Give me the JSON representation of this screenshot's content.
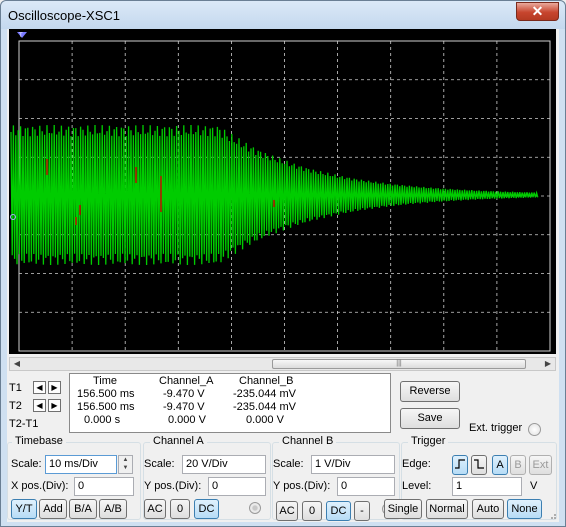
{
  "window": {
    "title": "Oscilloscope-XSC1",
    "close_label": "✕"
  },
  "screen": {
    "background": "#000000",
    "grid_color": "#d0d0d0",
    "trace_color": "#00cc00",
    "cursor_color": "#cc0000",
    "marker_t1": "T",
    "marker_t2": "T"
  },
  "scrollbar": {
    "left": "◀",
    "right": "▶",
    "grip": "|||"
  },
  "cursors": {
    "t1": {
      "label": "T1",
      "prev": "◀",
      "next": "▶"
    },
    "t2": {
      "label": "T2",
      "prev": "◀",
      "next": "▶"
    },
    "diff": {
      "label": "T2-T1"
    }
  },
  "readout": {
    "headers": [
      "Time",
      "Channel_A",
      "Channel_B"
    ],
    "rows": [
      [
        "156.500 ms",
        "-9.470 V",
        "-235.044 mV"
      ],
      [
        "156.500 ms",
        "-9.470 V",
        "-235.044 mV"
      ],
      [
        "0.000 s",
        "0.000 V",
        "0.000 V"
      ]
    ]
  },
  "buttons": {
    "reverse": "Reverse",
    "save": "Save",
    "ext_trigger": "Ext. trigger"
  },
  "timebase": {
    "title": "Timebase",
    "scale_label": "Scale:",
    "scale_value": "10 ms/Div",
    "xpos_label": "X pos.(Div):",
    "xpos_value": "0",
    "modes": [
      "Y/T",
      "Add",
      "B/A",
      "A/B"
    ]
  },
  "channel_a": {
    "title": "Channel A",
    "scale_label": "Scale:",
    "scale_value": "20  V/Div",
    "ypos_label": "Y pos.(Div):",
    "ypos_value": "0",
    "coupling": [
      "AC",
      "0",
      "DC"
    ]
  },
  "channel_b": {
    "title": "Channel B",
    "scale_label": "Scale:",
    "scale_value": "1  V/Div",
    "ypos_label": "Y pos.(Div):",
    "ypos_value": "0",
    "coupling": [
      "AC",
      "0",
      "DC",
      "-"
    ]
  },
  "trigger": {
    "title": "Trigger",
    "edge_label": "Edge:",
    "edge_buttons": [
      "f",
      "t",
      "A",
      "B",
      "Ext"
    ],
    "level_label": "Level:",
    "level_value": "1",
    "level_unit": "V",
    "modes": [
      "Single",
      "Normal",
      "Auto",
      "None"
    ]
  }
}
